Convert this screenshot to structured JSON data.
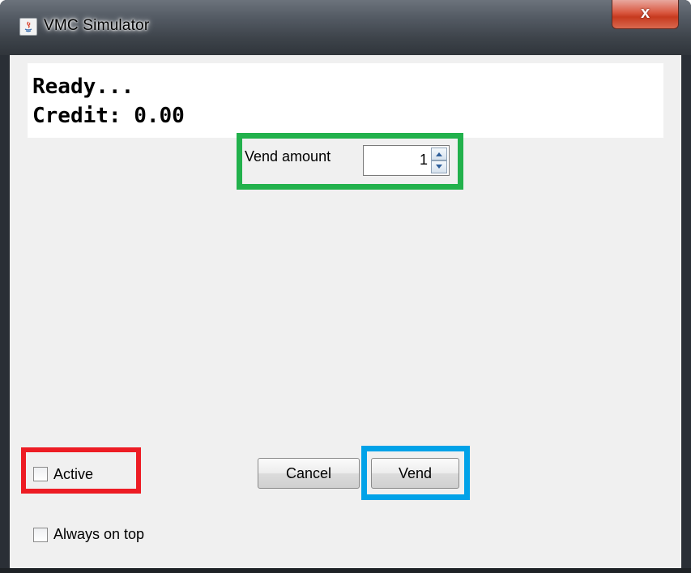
{
  "window": {
    "title": "VMC Simulator",
    "close_label": "x"
  },
  "display": {
    "status": "Ready...",
    "credit": "Credit: 0.00"
  },
  "vend_amount": {
    "label": "Vend amount",
    "value": "1"
  },
  "checkboxes": {
    "active": {
      "label": "Active",
      "checked": false
    },
    "always_on_top": {
      "label": "Always on top",
      "checked": false
    }
  },
  "buttons": {
    "cancel": "Cancel",
    "vend": "Vend"
  },
  "highlight_colors": {
    "vend_amount": "#22b14c",
    "active": "#ed1c24",
    "vend": "#00a2e8"
  }
}
